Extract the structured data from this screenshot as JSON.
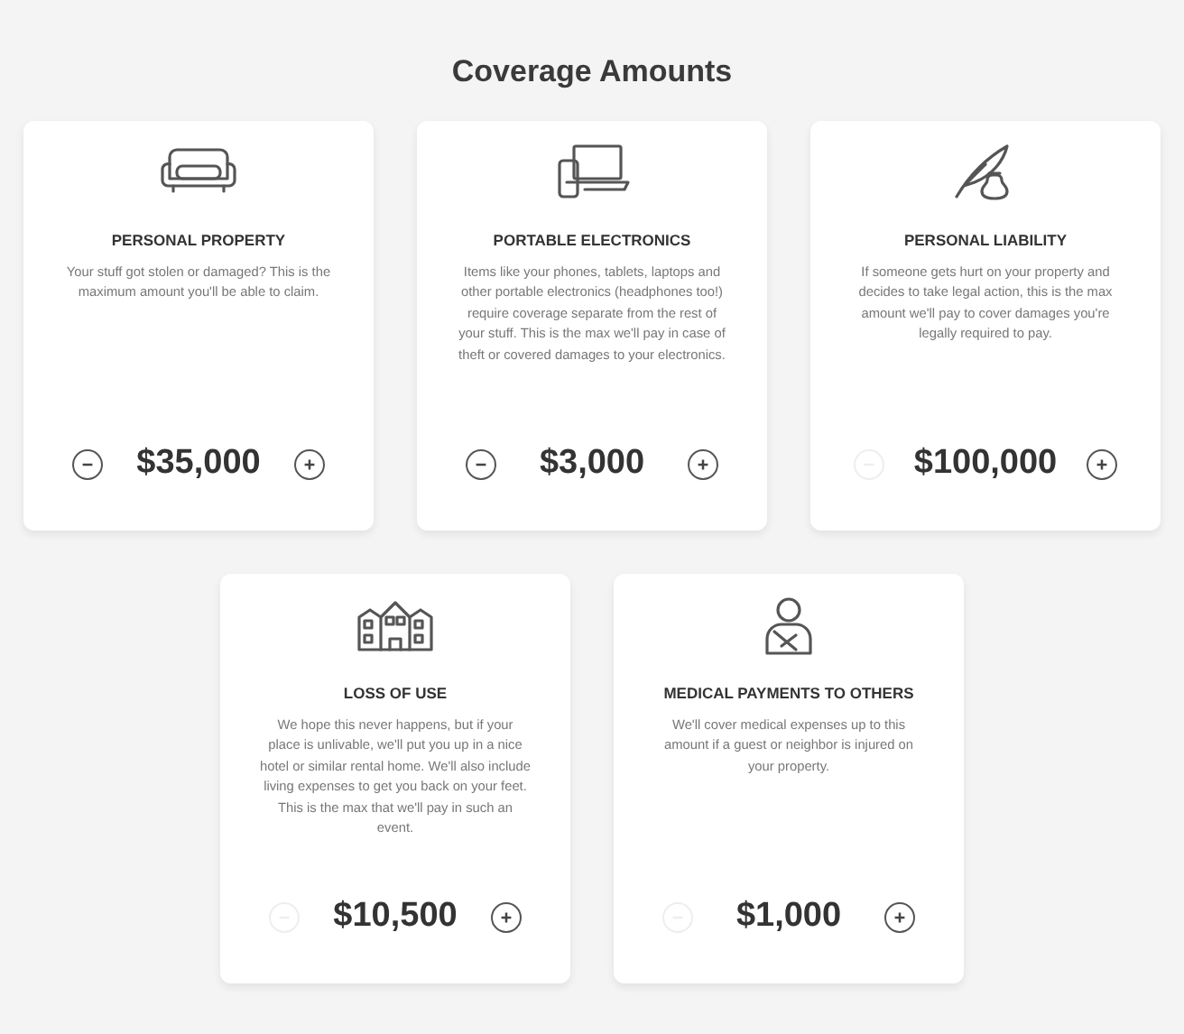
{
  "title": "Coverage Amounts",
  "cards": [
    {
      "title": "PERSONAL PROPERTY",
      "description": "Your stuff got stolen or damaged? This is the maximum amount you'll be able to claim.",
      "amount": "$35,000",
      "decrease_disabled": false,
      "increase_disabled": false
    },
    {
      "title": "PORTABLE ELECTRONICS",
      "description": "Items like your phones, tablets, laptops and other portable electronics (headphones too!) require coverage separate from the rest of your stuff. This is the max we'll pay in case of theft or covered damages to your electronics.",
      "amount": "$3,000",
      "decrease_disabled": false,
      "increase_disabled": false
    },
    {
      "title": "PERSONAL LIABILITY",
      "description": "If someone gets hurt on your property and decides to take legal action, this is the max amount we'll pay to cover damages you're legally required to pay.",
      "amount": "$100,000",
      "decrease_disabled": true,
      "increase_disabled": false
    },
    {
      "title": "LOSS OF USE",
      "description": "We hope this never happens, but if your place is unlivable, we'll put you up in a nice hotel or similar rental home. We'll also include living expenses to get you back on your feet. This is the max that we'll pay in such an event.",
      "amount": "$10,500",
      "decrease_disabled": true,
      "increase_disabled": false
    },
    {
      "title": "MEDICAL PAYMENTS TO OTHERS",
      "description": "We'll cover medical expenses up to this amount if a guest or neighbor is injured on your property.",
      "amount": "$1,000",
      "decrease_disabled": true,
      "increase_disabled": false
    }
  ]
}
